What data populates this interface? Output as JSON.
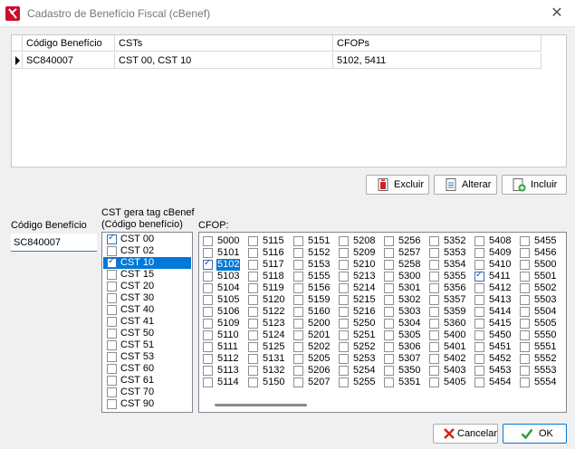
{
  "window": {
    "title": "Cadastro de Benefício Fiscal (cBenef)",
    "close_glyph": "✕"
  },
  "grid": {
    "headers": [
      "Código Benefício",
      "CSTs",
      "CFOPs"
    ],
    "rows": [
      {
        "code": "SC840007",
        "csts": "CST 00, CST 10",
        "cfops": "5102, 5411"
      }
    ]
  },
  "buttons": {
    "excluir": "Excluir",
    "alterar": "Alterar",
    "incluir": "Incluir",
    "cancelar": "Cancelar",
    "ok": "OK"
  },
  "form": {
    "code_label": "Código Benefício",
    "code_value": "SC840007",
    "cst_label_1": "CST gera tag cBenef",
    "cst_label_2": "(Código benefício)",
    "cfop_label": "CFOP:"
  },
  "cst_options": [
    {
      "label": "CST 00",
      "checked": true,
      "selected": false
    },
    {
      "label": "CST 02",
      "checked": false,
      "selected": false
    },
    {
      "label": "CST 10",
      "checked": true,
      "selected": true
    },
    {
      "label": "CST 15",
      "checked": false,
      "selected": false
    },
    {
      "label": "CST 20",
      "checked": false,
      "selected": false
    },
    {
      "label": "CST 30",
      "checked": false,
      "selected": false
    },
    {
      "label": "CST 40",
      "checked": false,
      "selected": false
    },
    {
      "label": "CST 41",
      "checked": false,
      "selected": false
    },
    {
      "label": "CST 50",
      "checked": false,
      "selected": false
    },
    {
      "label": "CST 51",
      "checked": false,
      "selected": false
    },
    {
      "label": "CST 53",
      "checked": false,
      "selected": false
    },
    {
      "label": "CST 60",
      "checked": false,
      "selected": false
    },
    {
      "label": "CST 61",
      "checked": false,
      "selected": false
    },
    {
      "label": "CST 70",
      "checked": false,
      "selected": false
    },
    {
      "label": "CST 90",
      "checked": false,
      "selected": false
    }
  ],
  "cfop_columns": [
    [
      "5000",
      "5101",
      "5102",
      "5103",
      "5104",
      "5105",
      "5106",
      "5109",
      "5110",
      "5111",
      "5112",
      "5113",
      "5114"
    ],
    [
      "5115",
      "5116",
      "5117",
      "5118",
      "5119",
      "5120",
      "5122",
      "5123",
      "5124",
      "5125",
      "5131",
      "5132",
      "5150"
    ],
    [
      "5151",
      "5152",
      "5153",
      "5155",
      "5156",
      "5159",
      "5160",
      "5200",
      "5201",
      "5202",
      "5205",
      "5206",
      "5207"
    ],
    [
      "5208",
      "5209",
      "5210",
      "5213",
      "5214",
      "5215",
      "5216",
      "5250",
      "5251",
      "5252",
      "5253",
      "5254",
      "5255"
    ],
    [
      "5256",
      "5257",
      "5258",
      "5300",
      "5301",
      "5302",
      "5303",
      "5304",
      "5305",
      "5306",
      "5307",
      "5350",
      "5351"
    ],
    [
      "5352",
      "5353",
      "5354",
      "5355",
      "5356",
      "5357",
      "5359",
      "5360",
      "5400",
      "5401",
      "5402",
      "5403",
      "5405"
    ],
    [
      "5408",
      "5409",
      "5410",
      "5411",
      "5412",
      "5413",
      "5414",
      "5415",
      "5450",
      "5451",
      "5452",
      "5453",
      "5454"
    ],
    [
      "5455",
      "5456",
      "5500",
      "5501",
      "5502",
      "5503",
      "5504",
      "5505",
      "5550",
      "5551",
      "5552",
      "5553",
      "5554"
    ]
  ],
  "cfop_checked": [
    "5102",
    "5411"
  ],
  "cfop_selected": [
    "5102"
  ]
}
